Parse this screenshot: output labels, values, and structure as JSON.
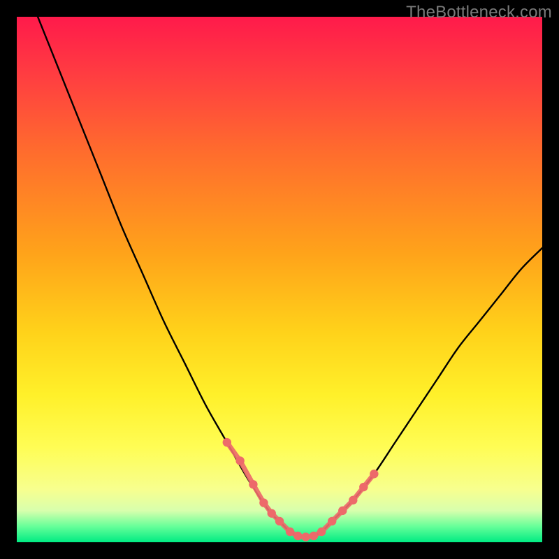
{
  "watermark": "TheBottleneck.com",
  "chart_data": {
    "type": "line",
    "title": "",
    "xlabel": "",
    "ylabel": "",
    "xlim": [
      0,
      100
    ],
    "ylim": [
      0,
      100
    ],
    "grid": false,
    "legend": false,
    "colors": {
      "curve": "#000000",
      "markers": "#ed6a6a",
      "markers_stroke": "#c94f4f"
    },
    "series": [
      {
        "name": "bottleneck-curve",
        "x": [
          4,
          8,
          12,
          16,
          20,
          24,
          28,
          32,
          36,
          40,
          44,
          48,
          50,
          52,
          54,
          56,
          58,
          60,
          64,
          68,
          72,
          76,
          80,
          84,
          88,
          92,
          96,
          100
        ],
        "y": [
          100,
          90,
          80,
          70,
          60,
          51,
          42,
          34,
          26,
          19,
          12,
          6,
          4,
          2,
          1,
          1,
          2,
          4,
          8,
          13,
          19,
          25,
          31,
          37,
          42,
          47,
          52,
          56
        ]
      }
    ],
    "markers": {
      "name": "highlight-points",
      "x": [
        40,
        42.5,
        45,
        47,
        48.5,
        50,
        52,
        53.5,
        55,
        56.5,
        58,
        60,
        62,
        64,
        66,
        68
      ],
      "y": [
        19,
        15.5,
        11,
        7.5,
        5.5,
        4,
        2,
        1.2,
        1,
        1.2,
        2,
        4,
        6,
        8,
        10.5,
        13
      ]
    }
  }
}
